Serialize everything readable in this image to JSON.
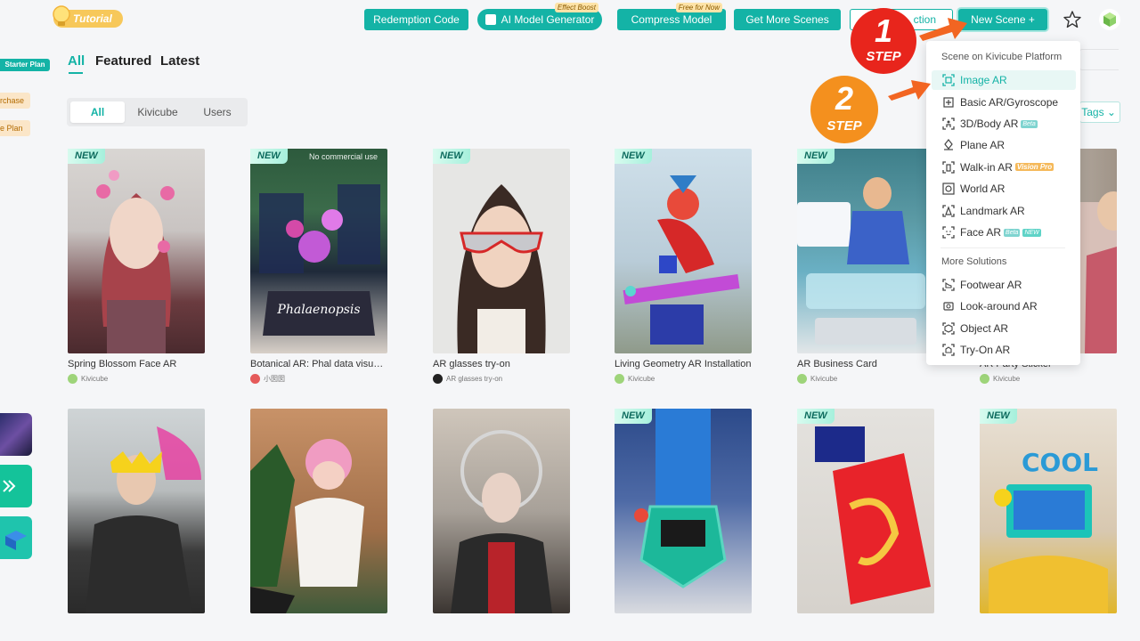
{
  "header": {
    "tutorial_label": "Tutorial",
    "redemption_label": "Redemption Code",
    "ai_model_label": "AI Model Generator",
    "ai_model_tag": "Effect Boost",
    "compress_label": "Compress Model",
    "compress_tag": "Free for Now",
    "more_scenes_label": "Get More Scenes",
    "collection_label": "ction",
    "new_scene_label": "New Scene +"
  },
  "sidebar": {
    "starter_plan": "Starter Plan",
    "purchase": "rchase",
    "plan": "e Plan"
  },
  "tabs": {
    "all": "All",
    "featured": "Featured",
    "latest": "Latest"
  },
  "segment": {
    "all": "All",
    "kivicube": "Kivicube",
    "users": "Users"
  },
  "tags_label": "Tags ⌄",
  "badges": {
    "new": "NEW",
    "no_commercial": "No commercial use"
  },
  "cards": [
    {
      "title": "Spring Blossom Face AR",
      "author": "Kivicube"
    },
    {
      "title": "Botanical AR: Phal data visualization",
      "author": "小囡囡"
    },
    {
      "title": "AR glasses try-on",
      "author": "AR glasses try-on"
    },
    {
      "title": "Living Geometry AR Installation",
      "author": "Kivicube"
    },
    {
      "title": "AR Business Card",
      "author": "Kivicube"
    },
    {
      "title": "AR Party Sticker",
      "author": "Kivicube"
    }
  ],
  "dropdown": {
    "section1": "Scene on Kivicube Platform",
    "items": [
      {
        "label": "Image AR"
      },
      {
        "label": "Basic AR/Gyroscope"
      },
      {
        "label": "3D/Body AR",
        "badge": "Beta"
      },
      {
        "label": "Plane AR"
      },
      {
        "label": "Walk-in AR",
        "badge": "Vision Pro"
      },
      {
        "label": "World AR"
      },
      {
        "label": "Landmark AR"
      },
      {
        "label": "Face AR",
        "badge": "Beta",
        "badge2": "NEW"
      }
    ],
    "section2": "More Solutions",
    "more": [
      {
        "label": "Footwear AR"
      },
      {
        "label": "Look-around AR"
      },
      {
        "label": "Object AR"
      },
      {
        "label": "Try-On AR"
      }
    ]
  },
  "steps": {
    "step1_num": "1",
    "step2_num": "2",
    "step_word": "STEP"
  },
  "colors": {
    "accent": "#14b3a6",
    "step1": "#e8251c",
    "step2": "#f4901e",
    "arrow": "#f26522"
  }
}
